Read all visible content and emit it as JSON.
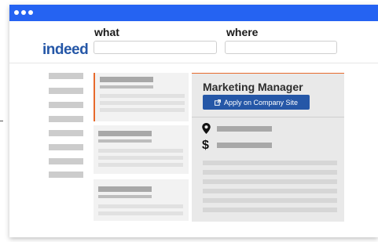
{
  "brand": {
    "logo_text": "indeed",
    "logo_color": "#2557a7"
  },
  "window": {
    "titlebar_color": "#2563f2"
  },
  "search": {
    "what_label": "what",
    "what_value": "",
    "where_label": "where",
    "where_value": ""
  },
  "job_detail": {
    "title": "Marketing Manager",
    "apply_label": "Apply on Company Site",
    "apply_color": "#2557a7",
    "accent_color": "#e76a2c",
    "location_icon": "map-pin-icon",
    "salary_icon": "dollar-icon",
    "salary_symbol": "$"
  }
}
